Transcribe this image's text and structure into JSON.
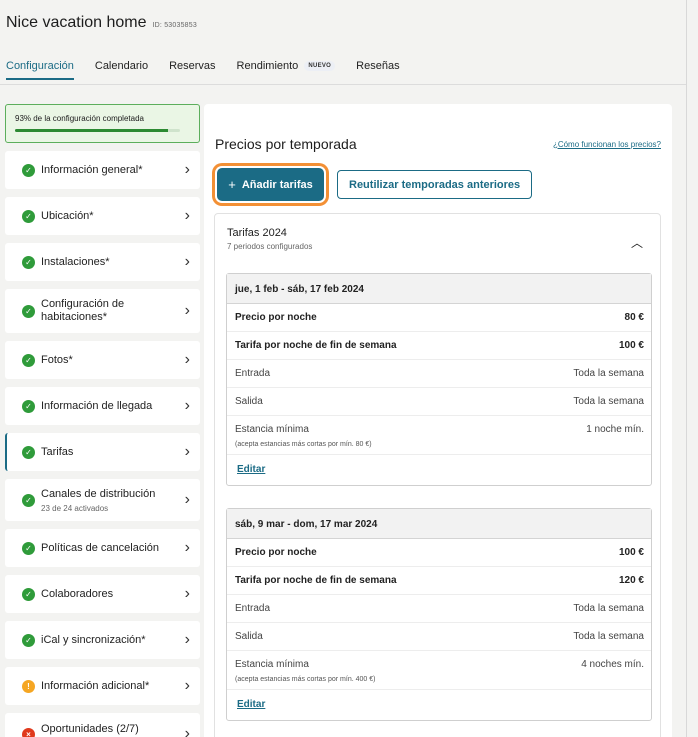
{
  "property": {
    "title": "Nice vacation home",
    "id_label": "ID: 53035853"
  },
  "tabs": [
    {
      "label": "Configuración",
      "active": true
    },
    {
      "label": "Calendario"
    },
    {
      "label": "Reservas"
    },
    {
      "label": "Rendimiento",
      "badge": "NUEVO"
    },
    {
      "label": "Reseñas"
    }
  ],
  "progress": {
    "label": "93% de la configuración completada",
    "percent": 93
  },
  "sidebar": {
    "items": [
      {
        "label": "Información general*",
        "status": "ok"
      },
      {
        "label": "Ubicación*",
        "status": "ok"
      },
      {
        "label": "Instalaciones*",
        "status": "ok"
      },
      {
        "label": "Configuración de habitaciones*",
        "status": "ok"
      },
      {
        "label": "Fotos*",
        "status": "ok"
      },
      {
        "label": "Información de llegada",
        "status": "ok"
      },
      {
        "label": "Tarifas",
        "status": "ok",
        "active": true
      },
      {
        "label": "Canales de distribución",
        "sub": "23 de 24 activados",
        "status": "ok"
      },
      {
        "label": "Políticas de cancelación",
        "status": "ok"
      },
      {
        "label": "Colaboradores",
        "status": "ok"
      },
      {
        "label": "iCal y sincronización*",
        "status": "ok"
      },
      {
        "label": "Información adicional*",
        "status": "warn"
      },
      {
        "label": "Oportunidades (2/7)",
        "status": "err",
        "progress": 0.2857
      }
    ]
  },
  "main": {
    "title": "Precios por temporada",
    "help_link": "¿Cómo funcionan los precios?",
    "add_button": "Añadir tarifas",
    "reuse_button": "Reutilizar temporadas anteriores"
  },
  "year": {
    "title": "Tarifas 2024",
    "subtitle": "7 periodos configurados"
  },
  "periods": [
    {
      "range": "jue, 1 feb - sáb, 17 feb 2024",
      "price_label": "Precio por noche",
      "price": "80 €",
      "weekend_label": "Tarifa por noche de fin de semana",
      "weekend": "100 €",
      "checkin_label": "Entrada",
      "checkin": "Toda la semana",
      "checkout_label": "Salida",
      "checkout": "Toda la semana",
      "min_label": "Estancia mínima",
      "min": "1 noche mín.",
      "note": "(acepta estancias más cortas por mín. 80 €)",
      "edit": "Editar"
    },
    {
      "range": "sáb, 9 mar - dom, 17 mar 2024",
      "price_label": "Precio por noche",
      "price": "100 €",
      "weekend_label": "Tarifa por noche de fin de semana",
      "weekend": "120 €",
      "checkin_label": "Entrada",
      "checkin": "Toda la semana",
      "checkout_label": "Salida",
      "checkout": "Toda la semana",
      "min_label": "Estancia mínima",
      "min": "4 noches mín.",
      "note": "(acepta estancias más cortas por mín. 400 €)",
      "edit": "Editar"
    }
  ],
  "colors": {
    "accent": "#1b6b85",
    "focus_ring": "#f39035",
    "ok": "#2f9b3a",
    "warn": "#f5a623",
    "error": "#e03a1d"
  },
  "icons": {
    "ok": "check-circle-icon",
    "warn": "warning-circle-icon",
    "err": "error-circle-icon",
    "chevron": "chevron-right-icon",
    "collapse": "chevron-up-icon",
    "add": "plus-icon"
  }
}
